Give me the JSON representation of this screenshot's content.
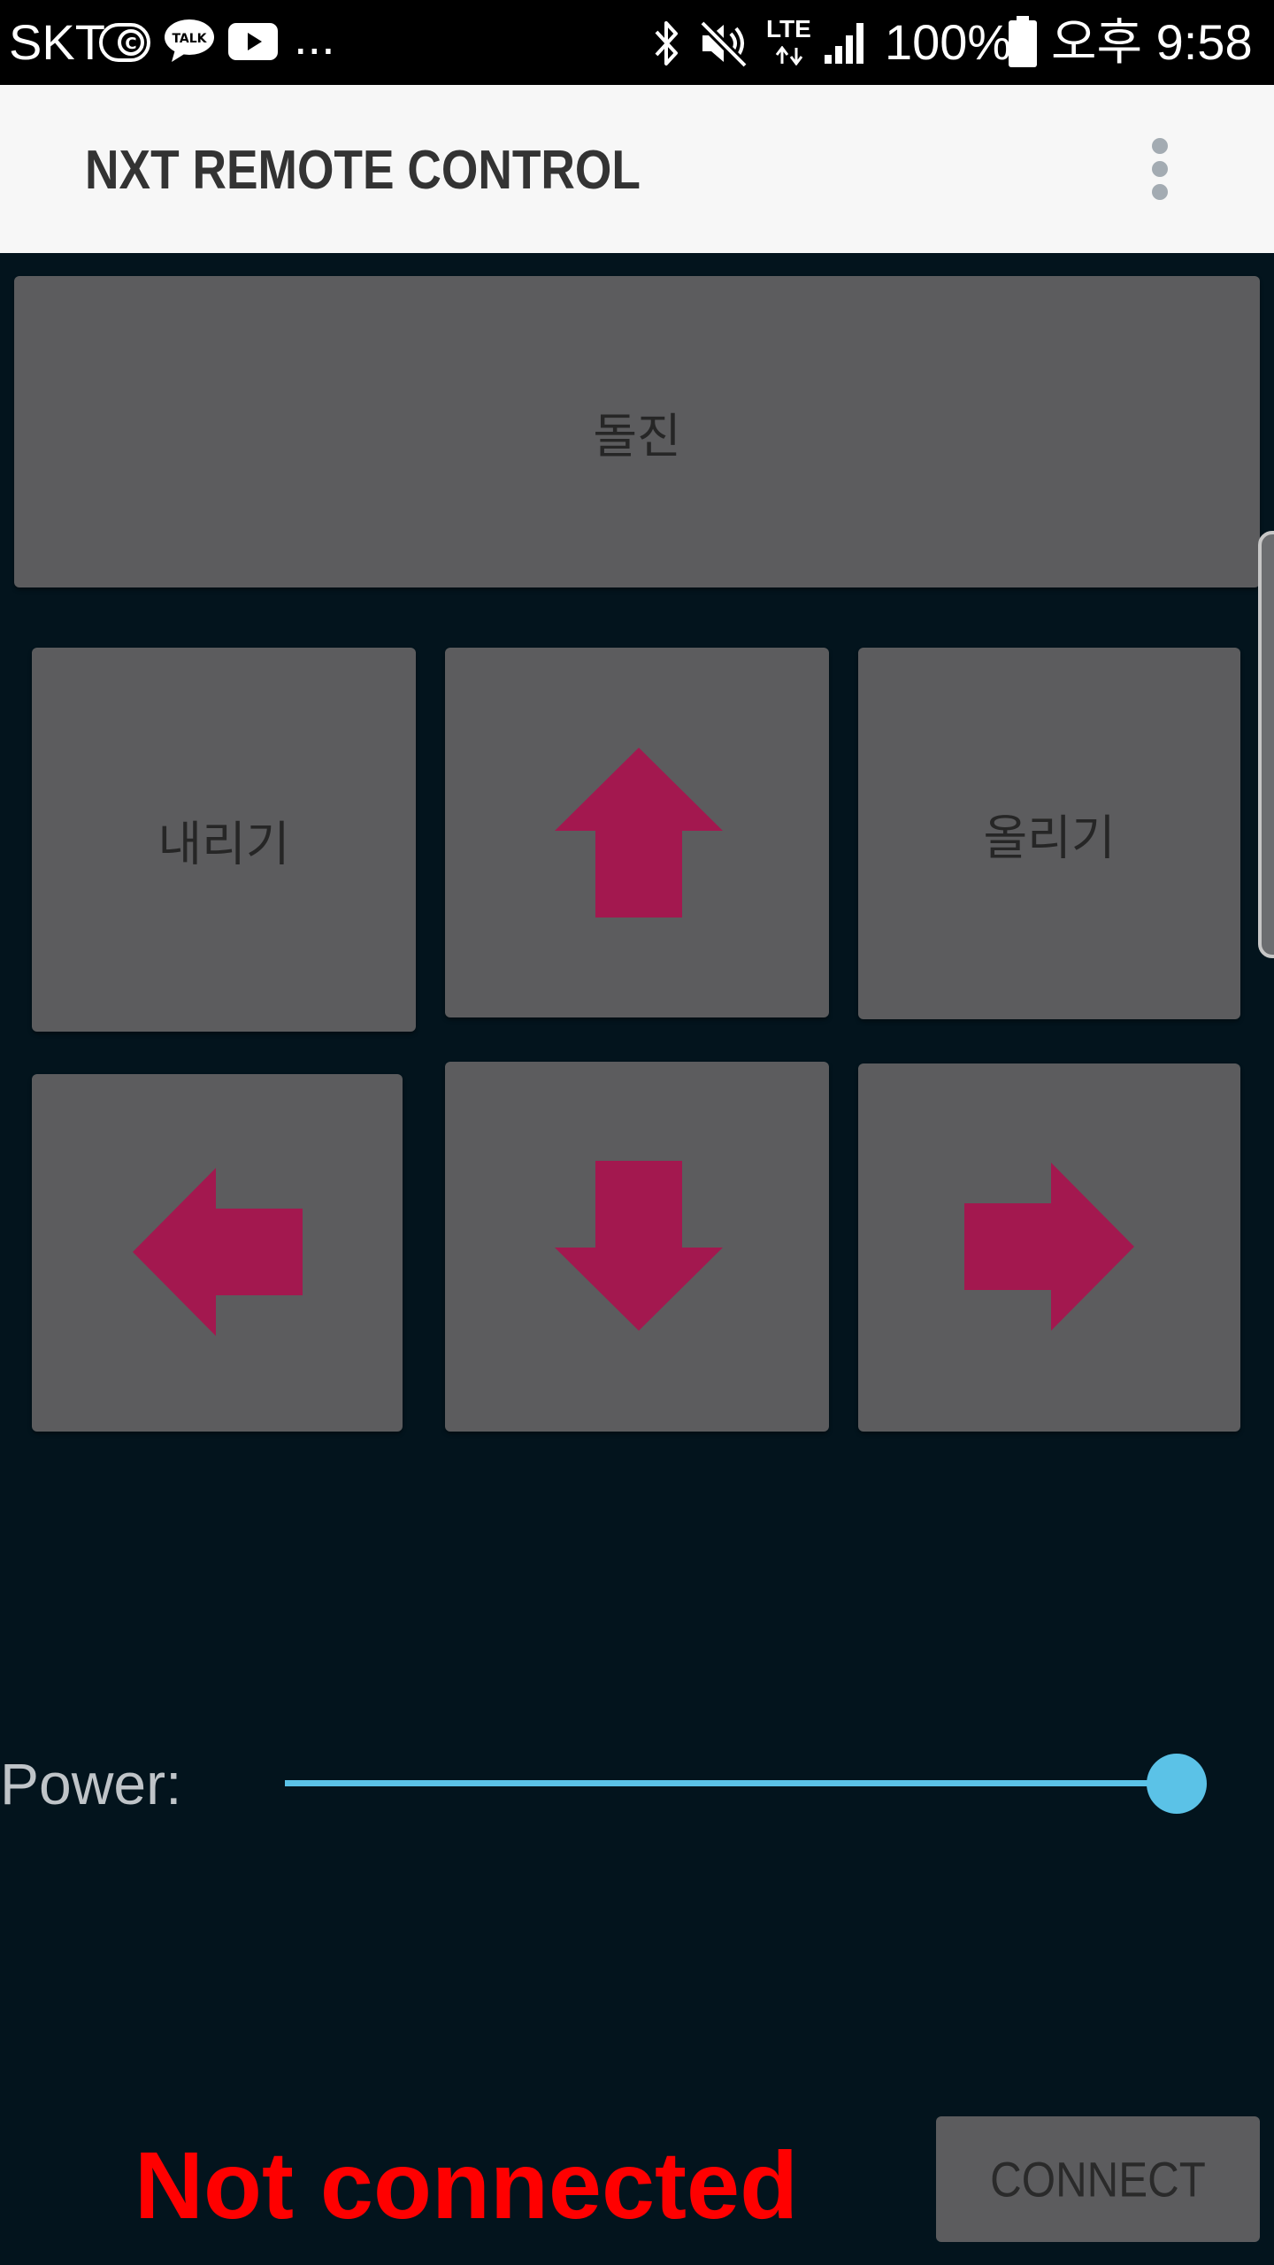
{
  "status_bar": {
    "carrier": "SKT",
    "more": "...",
    "network": "LTE",
    "battery": "100%",
    "time": "오후 9:58",
    "icons": [
      "c-circle-icon",
      "kakaotalk-icon",
      "youtube-icon",
      "bluetooth-icon",
      "mute-icon",
      "lte-icon",
      "signal-icon",
      "battery-icon"
    ],
    "talk_badge": "TALK"
  },
  "app_bar": {
    "title": "NXT REMOTE CONTROL",
    "menu_icon": "overflow-menu-icon"
  },
  "controls": {
    "charge_label": "돌진",
    "lower_label": "내리기",
    "raise_label": "올리기",
    "forward_icon": "arrow-up-icon",
    "left_icon": "arrow-left-icon",
    "back_icon": "arrow-down-icon",
    "right_icon": "arrow-right-icon",
    "arrow_color": "#a3184f"
  },
  "power": {
    "label": "Power:",
    "value_fraction": 1.0,
    "accent_color": "#5bc2e7"
  },
  "connection": {
    "status": "Not connected",
    "status_color": "#ff0000",
    "connect_label": "CONNECT"
  }
}
